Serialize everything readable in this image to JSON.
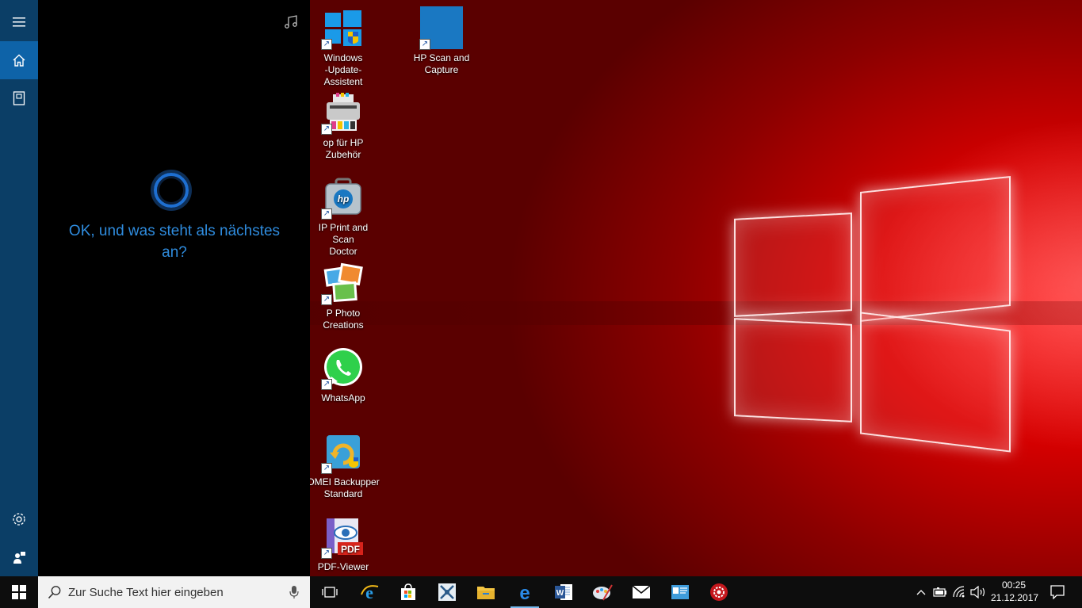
{
  "cortana": {
    "message": "OK, und was steht als nächstes an?",
    "rail": [
      {
        "name": "hamburger-menu-icon"
      },
      {
        "name": "home-icon"
      },
      {
        "name": "notebook-icon"
      },
      {
        "name": "settings-gear-icon"
      },
      {
        "name": "feedback-icon"
      }
    ],
    "music_icon": "music-note-icon"
  },
  "desktop": {
    "icons": [
      {
        "label": "Windows\n-Update-Assistent"
      },
      {
        "label": "HP Scan and Capture"
      },
      {
        "label": "op für HP Zubehör"
      },
      {
        "label": "IP Print and Scan\nDoctor"
      },
      {
        "label": "P Photo Creations"
      },
      {
        "label": "WhatsApp"
      },
      {
        "label": "OMEI Backupper\nStandard"
      },
      {
        "label": "PDF-Viewer"
      }
    ]
  },
  "taskbar": {
    "search_placeholder": "Zur Suche Text hier eingeben",
    "apps": [
      "task-view-icon",
      "internet-explorer-icon",
      "store-icon",
      "puzzle-app-icon",
      "file-explorer-icon",
      "edge-icon",
      "word-icon",
      "paint-app-icon",
      "mail-icon",
      "contacts-card-icon",
      "gear-app-icon"
    ],
    "clock_time": "00:25",
    "clock_date": "21.12.2017"
  },
  "colors": {
    "accent": "#0e63a8",
    "rail": "#0b3e66",
    "cortana_text": "#2f8cde"
  }
}
